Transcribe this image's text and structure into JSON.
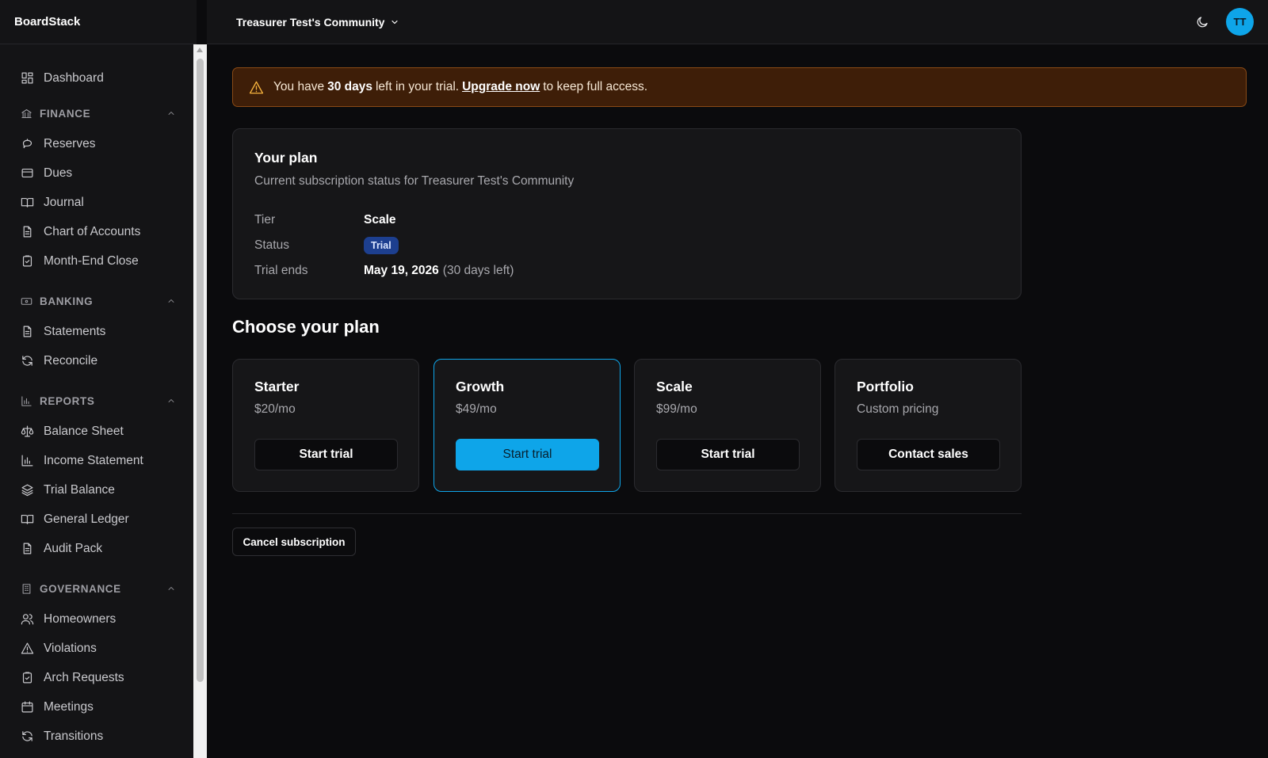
{
  "app": {
    "brand": "BoardStack"
  },
  "topbar": {
    "community": "Treasurer Test's Community",
    "avatar_initials": "TT"
  },
  "sidebar": {
    "dashboard": "Dashboard",
    "finance": {
      "label": "FINANCE",
      "items": [
        "Reserves",
        "Dues",
        "Journal",
        "Chart of Accounts",
        "Month-End Close"
      ]
    },
    "banking": {
      "label": "BANKING",
      "items": [
        "Statements",
        "Reconcile"
      ]
    },
    "reports": {
      "label": "REPORTS",
      "items": [
        "Balance Sheet",
        "Income Statement",
        "Trial Balance",
        "General Ledger",
        "Audit Pack"
      ]
    },
    "governance": {
      "label": "GOVERNANCE",
      "items": [
        "Homeowners",
        "Violations",
        "Arch Requests",
        "Meetings",
        "Transitions"
      ]
    }
  },
  "banner": {
    "prefix": "You have",
    "days": "30 days",
    "middle": "left in your trial.",
    "link": "Upgrade now",
    "suffix": "to keep full access."
  },
  "plan": {
    "title": "Your plan",
    "subtitle": "Current subscription status for Treasurer Test's Community",
    "tier_label": "Tier",
    "tier_value": "Scale",
    "status_label": "Status",
    "status_value": "Trial",
    "trial_ends_label": "Trial ends",
    "trial_ends_value": "May 19, 2026",
    "trial_ends_note": "(30 days left)"
  },
  "choose": {
    "title": "Choose your plan",
    "tiers": [
      {
        "name": "Starter",
        "price": "$20/mo",
        "button": "Start trial"
      },
      {
        "name": "Growth",
        "price": "$49/mo",
        "button": "Start trial"
      },
      {
        "name": "Scale",
        "price": "$99/mo",
        "button": "Start trial"
      },
      {
        "name": "Portfolio",
        "price": "Custom pricing",
        "button": "Contact sales"
      }
    ]
  },
  "cancel": "Cancel subscription",
  "colors": {
    "accent": "#0ea5e9",
    "banner_bg": "#3e1e08",
    "badge_bg": "#1d3f8f"
  }
}
